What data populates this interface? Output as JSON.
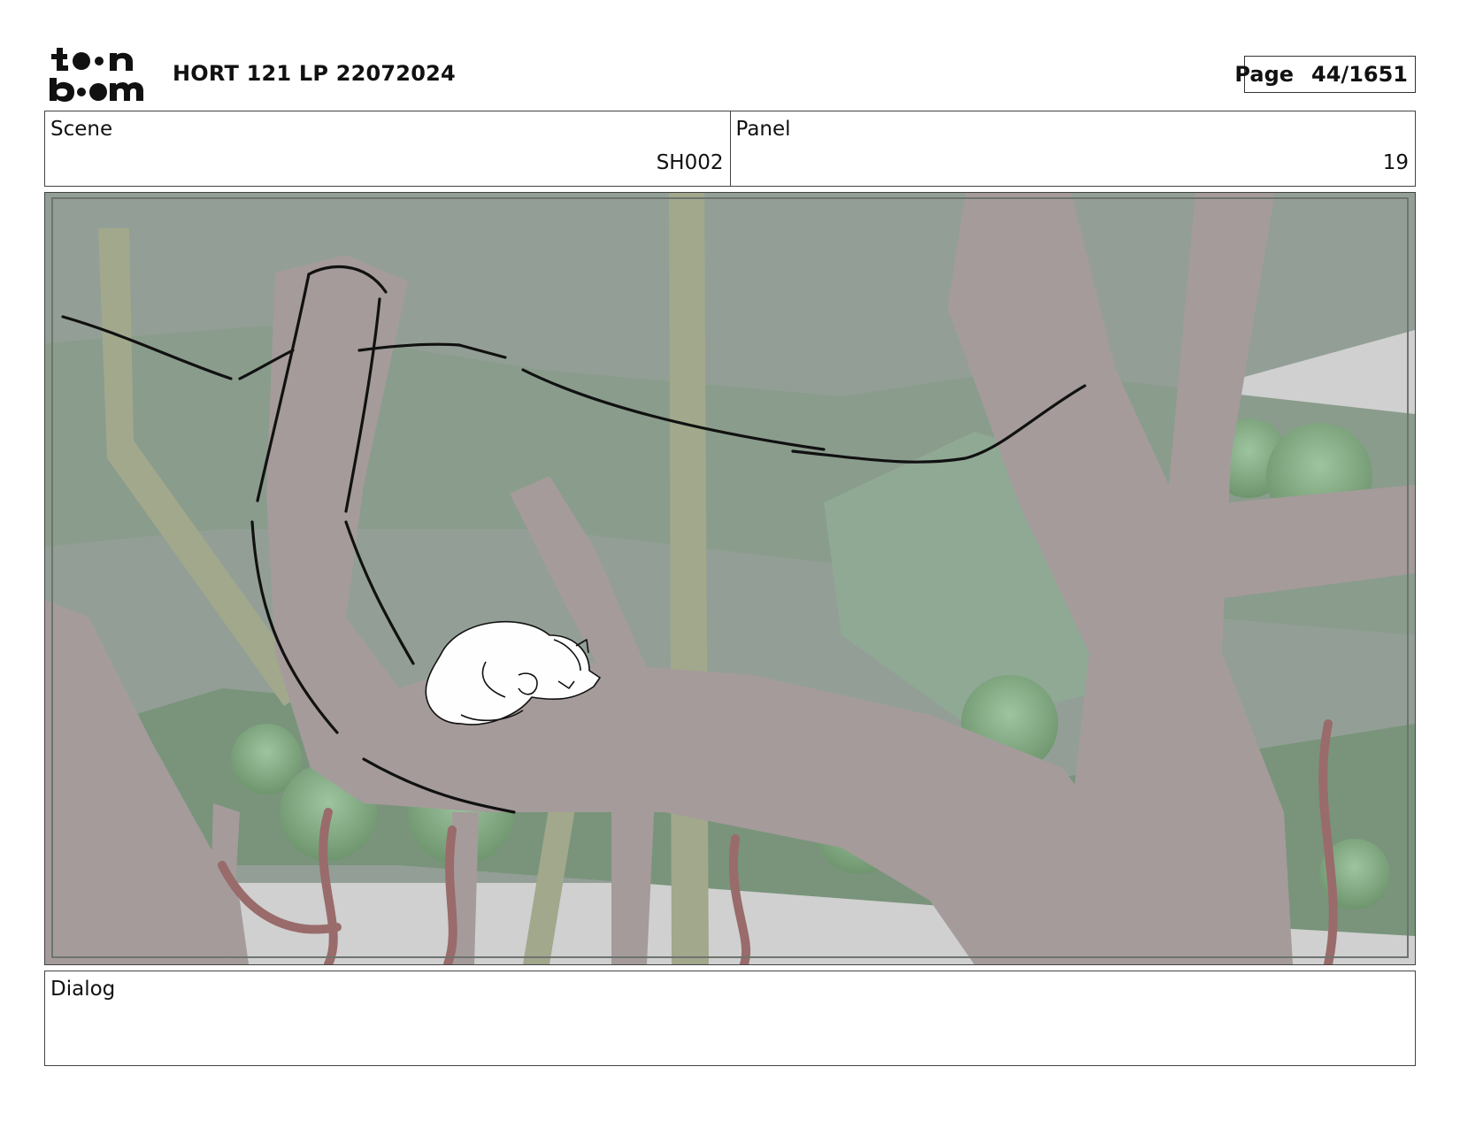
{
  "header": {
    "brand_logo": "toon boom",
    "title": "HORT 121 LP 22072024",
    "page_label": "Page",
    "page_number": "44/1651"
  },
  "scene": {
    "label": "Scene",
    "value": "SH002"
  },
  "panel": {
    "label": "Panel",
    "value": "19"
  },
  "dialog": {
    "label": "Dialog",
    "text": ""
  },
  "colors": {
    "sky": "#939f96",
    "trunk": "#a59b9b",
    "foliage": "#87a98a",
    "vine": "#a2a88c",
    "ink": "#111111"
  }
}
